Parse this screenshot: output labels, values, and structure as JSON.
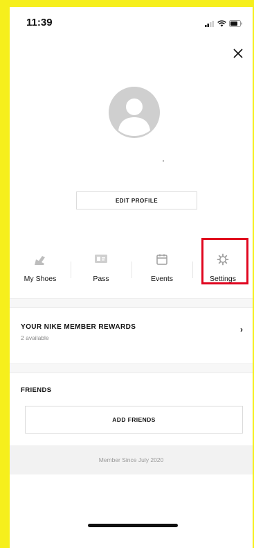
{
  "status_bar": {
    "time": "11:39"
  },
  "profile": {
    "edit_label": "EDIT PROFILE"
  },
  "quick_links": [
    {
      "label": "My Shoes",
      "icon": "shoe-icon"
    },
    {
      "label": "Pass",
      "icon": "pass-card-icon"
    },
    {
      "label": "Events",
      "icon": "calendar-icon"
    },
    {
      "label": "Settings",
      "icon": "gear-icon"
    }
  ],
  "rewards": {
    "title": "YOUR NIKE MEMBER REWARDS",
    "subtitle": "2 available"
  },
  "friends": {
    "title": "FRIENDS",
    "add_label": "ADD FRIENDS"
  },
  "footer": {
    "member_since": "Member Since July 2020"
  },
  "colors": {
    "frame": "#f6ef1c",
    "highlight": "#e0061f"
  }
}
